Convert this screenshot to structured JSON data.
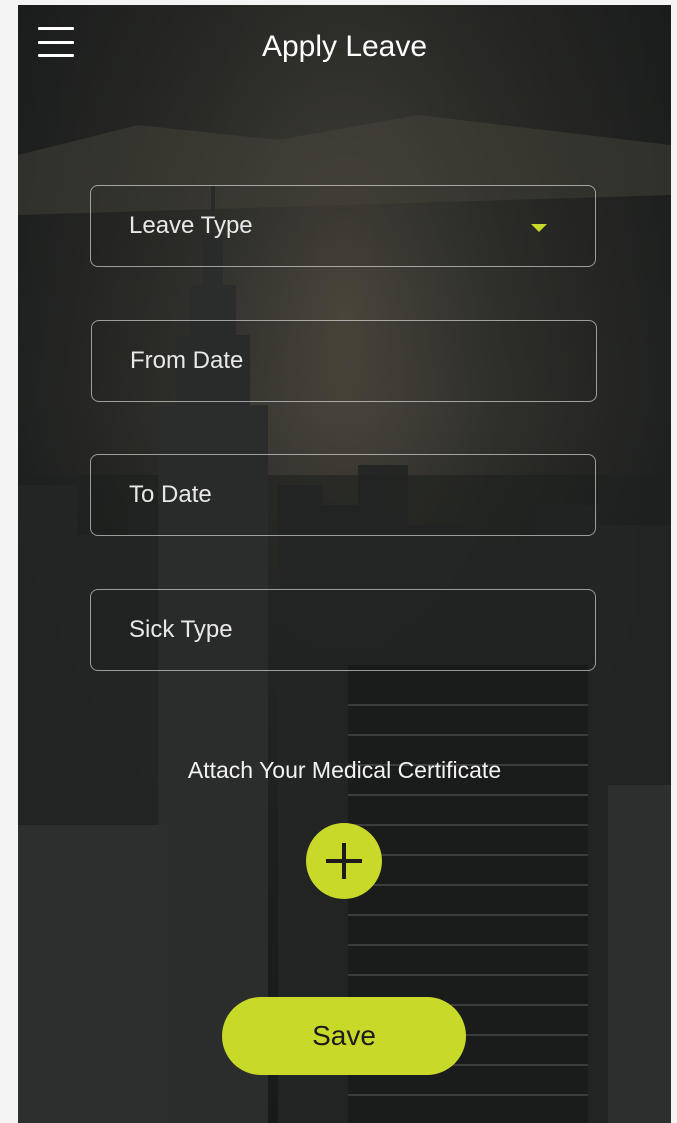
{
  "header": {
    "title": "Apply Leave",
    "menu_icon": "hamburger-menu-icon"
  },
  "form": {
    "leave_type": {
      "placeholder": "Leave Type",
      "icon": "dropdown-caret-icon"
    },
    "from_date": {
      "placeholder": "From Date"
    },
    "to_date": {
      "placeholder": "To Date"
    },
    "sick_type": {
      "placeholder": "Sick Type"
    }
  },
  "attachment": {
    "label": "Attach Your Medical Certificate",
    "icon": "plus-icon"
  },
  "actions": {
    "save_label": "Save"
  },
  "colors": {
    "accent": "#c8d92a",
    "text": "#ffffff",
    "field_border": "#bfbfbf"
  }
}
